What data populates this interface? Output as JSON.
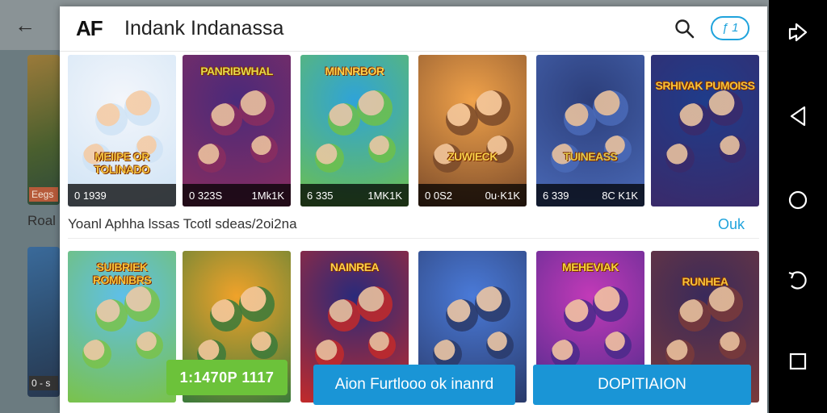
{
  "background_app": {
    "label": "Roal",
    "badge_top": "Eegs",
    "badge_bottom": "0 - s"
  },
  "dialog": {
    "logo": "AF",
    "title": "Indank Indanassa",
    "header_button": "ƒ 1",
    "section": {
      "left_text": "Yoanl Aphha lssas   Tcotl sdeas/2oi2na",
      "right_link": "Ouk"
    },
    "row1": [
      {
        "title": "MEIIPE OR TOLINADO",
        "left": "0 1939",
        "right": "",
        "accent": "#f5c542",
        "bg1": "#f3f6fb",
        "bg2": "#cfe3f5"
      },
      {
        "title": "PANRIBWHAL",
        "left": "0 323S",
        "right": "1Mk1K",
        "accent": "#e3d94a",
        "bg1": "#4a2a7a",
        "bg2": "#8a2d5f"
      },
      {
        "title": "MINNRBOR",
        "left": "6 335",
        "right": "1MK1K",
        "accent": "#ffd24a",
        "bg1": "#2fa3d8",
        "bg2": "#6ec04a"
      },
      {
        "title": "ZUWIECK",
        "left": "0 0S2",
        "right": "0u·K1K",
        "accent": "#f7d14a",
        "bg1": "#f0a24a",
        "bg2": "#7a4a2a"
      },
      {
        "title": "TUINEASS",
        "left": "6 339",
        "right": "8C K1K",
        "accent": "#e3c84a",
        "bg1": "#2c3e7a",
        "bg2": "#4a6ab8"
      },
      {
        "title": "SRHIVAK PUMOISS",
        "left": "",
        "right": "",
        "accent": "#f7c23a",
        "bg1": "#1f3c8a",
        "bg2": "#3a2a6a"
      }
    ],
    "row2": [
      {
        "title": "SUIBRIEK ROMNIBRS",
        "accent": "#f7c23a",
        "bg1": "#5fbfe8",
        "bg2": "#7ac24a"
      },
      {
        "title": "",
        "accent": "#f7c23a",
        "bg1": "#f0a22a",
        "bg2": "#3a7a3a"
      },
      {
        "title": "NAINREA",
        "accent": "#ffd24a",
        "bg1": "#2a2a7a",
        "bg2": "#c22a2a"
      },
      {
        "title": "",
        "accent": "#f7c23a",
        "bg1": "#4a7ad8",
        "bg2": "#2a3a6a"
      },
      {
        "title": "MEHEVIAK",
        "accent": "#f7d23a",
        "bg1": "#c23ab8",
        "bg2": "#4a2a8a"
      },
      {
        "title": "RUNHEA",
        "accent": "#f7c23a",
        "bg1": "#3a2a5a",
        "bg2": "#7a3a3a"
      }
    ],
    "green_pill": "1:1470P 1117",
    "button_left": "Aion Furtlooo ok inanrd",
    "button_right": "DOPITIAION"
  },
  "navbar": {
    "icons": [
      "share-icon",
      "back-triangle-icon",
      "home-circle-icon",
      "rotate-icon",
      "recents-square-icon"
    ]
  },
  "colors": {
    "accent": "#1fa3dc",
    "primary_button": "#1a95d6",
    "green": "#6cc23a"
  }
}
